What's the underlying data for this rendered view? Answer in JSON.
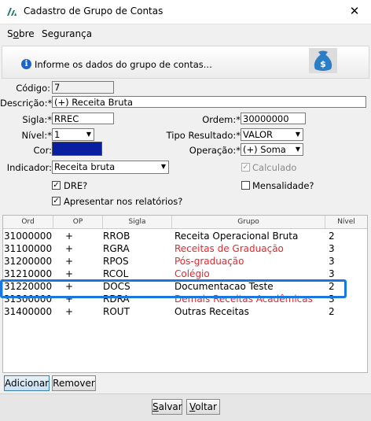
{
  "window": {
    "title": "Cadastro de Grupo de Contas",
    "close_glyph": "✕"
  },
  "menu": [
    {
      "label": "Sobre",
      "mnemonic": "o"
    },
    {
      "label": "Segurança",
      "mnemonic": ""
    }
  ],
  "info": {
    "text": "Informe os dados do grupo de contas...",
    "icon_glyph": "i"
  },
  "form": {
    "codigo": {
      "label": "Código:",
      "value": "7"
    },
    "descricao": {
      "label": "Descrição:*",
      "value": "(+) Receita Bruta"
    },
    "sigla": {
      "label": "Sigla:*",
      "value": "RREC"
    },
    "ordem": {
      "label": "Ordem:*",
      "value": "30000000"
    },
    "nivel": {
      "label": "Nível:*",
      "value": "1"
    },
    "tipo_resultado": {
      "label": "Tipo Resultado:*",
      "value": "VALOR"
    },
    "cor": {
      "label": "Cor:",
      "color": "#0a1ea0"
    },
    "operacao": {
      "label": "Operação:*",
      "value": "(+) Soma"
    },
    "indicador": {
      "label": "Indicador:",
      "value": "Receita bruta"
    },
    "calculado": {
      "label": "Calculado",
      "checked": true,
      "disabled": true
    },
    "dre": {
      "label": "DRE?",
      "checked": true
    },
    "mensalidade": {
      "label": "Mensalidade?",
      "checked": false
    },
    "apresentar": {
      "label": "Apresentar nos relatórios?",
      "checked": true
    },
    "check_glyph": "✓"
  },
  "table": {
    "columns": [
      "Ord",
      "OP",
      "Sigla",
      "Grupo",
      "Nível"
    ],
    "rows": [
      {
        "ord": "31000000",
        "op": "+",
        "sigla": "RROB",
        "grupo": "Receita Operacional Bruta",
        "nivel": "2",
        "red": false
      },
      {
        "ord": "31100000",
        "op": "+",
        "sigla": "RGRA",
        "grupo": "Receitas de Graduação",
        "nivel": "3",
        "red": true
      },
      {
        "ord": "31200000",
        "op": "+",
        "sigla": "RPOS",
        "grupo": "Pós-graduação",
        "nivel": "3",
        "red": true
      },
      {
        "ord": "31210000",
        "op": "+",
        "sigla": "RCOL",
        "grupo": "Colégio",
        "nivel": "3",
        "red": true
      },
      {
        "ord": "31220000",
        "op": "+",
        "sigla": "DOCS",
        "grupo": "Documentacao Teste",
        "nivel": "2",
        "red": false
      },
      {
        "ord": "31300000",
        "op": "+",
        "sigla": "RDRA",
        "grupo": "Demais Receitas Acadêmicas",
        "nivel": "3",
        "red": true
      },
      {
        "ord": "31400000",
        "op": "+",
        "sigla": "ROUT",
        "grupo": "Outras Receitas",
        "nivel": "2",
        "red": false
      }
    ]
  },
  "buttons": {
    "adicionar": "Adicionar",
    "remover": "Remover",
    "salvar": "Salvar",
    "voltar": "Voltar"
  },
  "colors": {
    "highlight": "#1877e0",
    "red_text": "#e8262b"
  }
}
